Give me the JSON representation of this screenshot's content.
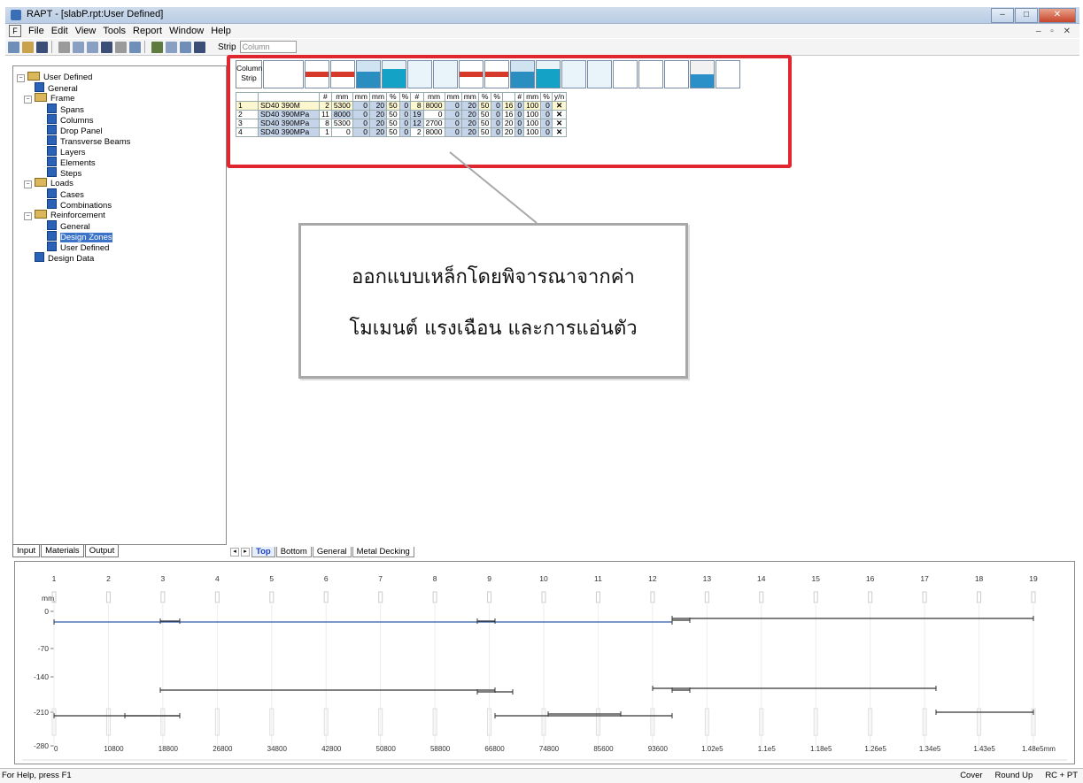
{
  "window": {
    "title": "RAPT - [slabP.rpt:User Defined]"
  },
  "menu": [
    "File",
    "Edit",
    "View",
    "Tools",
    "Report",
    "Window",
    "Help"
  ],
  "toolbar": {
    "strip_label": "Strip",
    "strip_value": "Column"
  },
  "tree": {
    "user_defined": "User Defined",
    "general": "General",
    "frame": "Frame",
    "spans": "Spans",
    "columns": "Columns",
    "drop_panel": "Drop Panel",
    "transverse_beams": "Transverse Beams",
    "layers": "Layers",
    "elements": "Elements",
    "steps": "Steps",
    "loads": "Loads",
    "cases": "Cases",
    "combinations": "Combinations",
    "reinforcement": "Reinforcement",
    "rf_general": "General",
    "design_zones": "Design Zones",
    "rf_user_defined": "User Defined",
    "design_data": "Design Data"
  },
  "left_tabs": [
    "Input",
    "Materials",
    "Output"
  ],
  "grid": {
    "col_strip_label": "Column Strip",
    "units": [
      "",
      "",
      "#",
      "mm",
      "mm",
      "mm",
      "%",
      "%",
      "#",
      "mm",
      "mm",
      "mm",
      "%",
      "%",
      "",
      "#",
      "mm",
      "%",
      "y/n"
    ],
    "rows": [
      [
        "1",
        "SD40 390M",
        "2",
        "5300",
        "0",
        "20",
        "50",
        "0",
        "8",
        "8000",
        "0",
        "20",
        "50",
        "0",
        "16",
        "0",
        "100",
        "0",
        "✕"
      ],
      [
        "2",
        "SD40 390MPa",
        "11",
        "8000",
        "0",
        "20",
        "50",
        "0",
        "19",
        "0",
        "0",
        "20",
        "50",
        "0",
        "16",
        "0",
        "100",
        "0",
        "✕"
      ],
      [
        "3",
        "SD40 390MPa",
        "8",
        "5300",
        "0",
        "20",
        "50",
        "0",
        "12",
        "2700",
        "0",
        "20",
        "50",
        "0",
        "20",
        "0",
        "100",
        "0",
        "✕"
      ],
      [
        "4",
        "SD40 390MPa",
        "1",
        "0",
        "0",
        "20",
        "50",
        "0",
        "2",
        "8000",
        "0",
        "20",
        "50",
        "0",
        "20",
        "0",
        "100",
        "0",
        "✕"
      ]
    ]
  },
  "callout": {
    "line1": "ออกแบบเหล็กโดยพิจารณาจากค่า",
    "line2": "โมเมนต์ แรงเฉือน และการแอ่นตัว"
  },
  "sheet_tabs": [
    "Top",
    "Bottom",
    "General",
    "Metal Decking"
  ],
  "diagram": {
    "unit": "mm",
    "span_labels": [
      "1",
      "2",
      "3",
      "4",
      "5",
      "6",
      "7",
      "8",
      "9",
      "10",
      "11",
      "12",
      "13",
      "14",
      "15",
      "16",
      "17",
      "18",
      "19"
    ],
    "y_labels": [
      "0",
      "-70",
      "-140",
      "-210",
      "-280"
    ],
    "x_labels": [
      "0",
      "10800",
      "18800",
      "26800",
      "34800",
      "42800",
      "50800",
      "58800",
      "66800",
      "74800",
      "85600",
      "93600",
      "1.02e5",
      "1.1e5",
      "1.18e5",
      "1.26e5",
      "1.34e5",
      "1.43e5",
      "1.48e5mm"
    ]
  },
  "status": {
    "help": "For Help, press F1",
    "cover": "Cover",
    "round": "Round Up",
    "mode": "RC + PT"
  }
}
